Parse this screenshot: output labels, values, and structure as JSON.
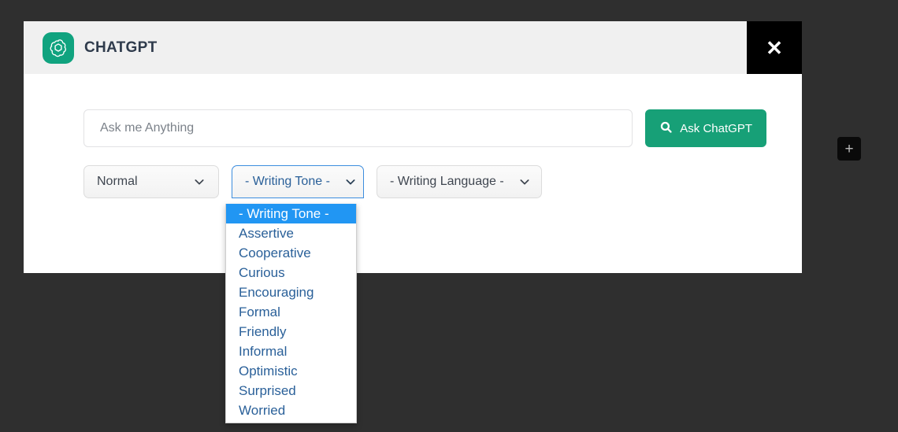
{
  "page": {
    "background_color": "#2f2f2f"
  },
  "modal": {
    "header": {
      "logo_icon": "chatgpt-logo-icon",
      "title": "CHATGPT",
      "close_label": "✕",
      "close_icon": "close-icon",
      "header_bg": "#f0f0f0",
      "logo_bg": "#10a37f"
    },
    "search": {
      "placeholder": "Ask me Anything",
      "value": "",
      "button_label": "Ask ChatGPT",
      "button_icon": "search-icon",
      "button_color": "#17a077"
    },
    "controls": {
      "mode_select": {
        "value": "Normal",
        "icon": "chevron-down-icon"
      },
      "tone_select": {
        "value": "- Writing Tone -",
        "icon": "chevron-down-icon",
        "focused": true,
        "focus_color": "#3c8dde"
      },
      "language_select": {
        "value": "- Writing Language -",
        "icon": "chevron-down-icon"
      }
    },
    "tone_dropdown": {
      "open": true,
      "highlight_color": "#2196f3",
      "option_color": "#2a6099",
      "selected_index": 0,
      "options": [
        "- Writing Tone -",
        "Assertive",
        "Cooperative",
        "Curious",
        "Encouraging",
        "Formal",
        "Friendly",
        "Informal",
        "Optimistic",
        "Surprised",
        "Worried"
      ]
    }
  },
  "floating": {
    "plus_button_label": "+",
    "plus_button_icon": "plus-icon"
  }
}
